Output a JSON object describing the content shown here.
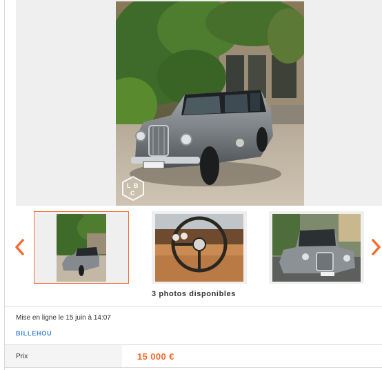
{
  "gallery": {
    "photo_count_text": "3 photos disponibles",
    "active_index": 0,
    "watermark_logo": "lbc-logo",
    "thumbnails": [
      {
        "subject": "taxi-front-house"
      },
      {
        "subject": "steering-wheel-interior"
      },
      {
        "subject": "taxi-street"
      }
    ]
  },
  "listing": {
    "posted_text": "Mise en ligne le 15 juin à 14:07",
    "seller_name": "BILLEHOU",
    "price_label": "Prix",
    "price_value": "15 000 €"
  },
  "colors": {
    "accent": "#f56b2a",
    "link": "#4183d7",
    "panel_bg": "#efefef"
  }
}
